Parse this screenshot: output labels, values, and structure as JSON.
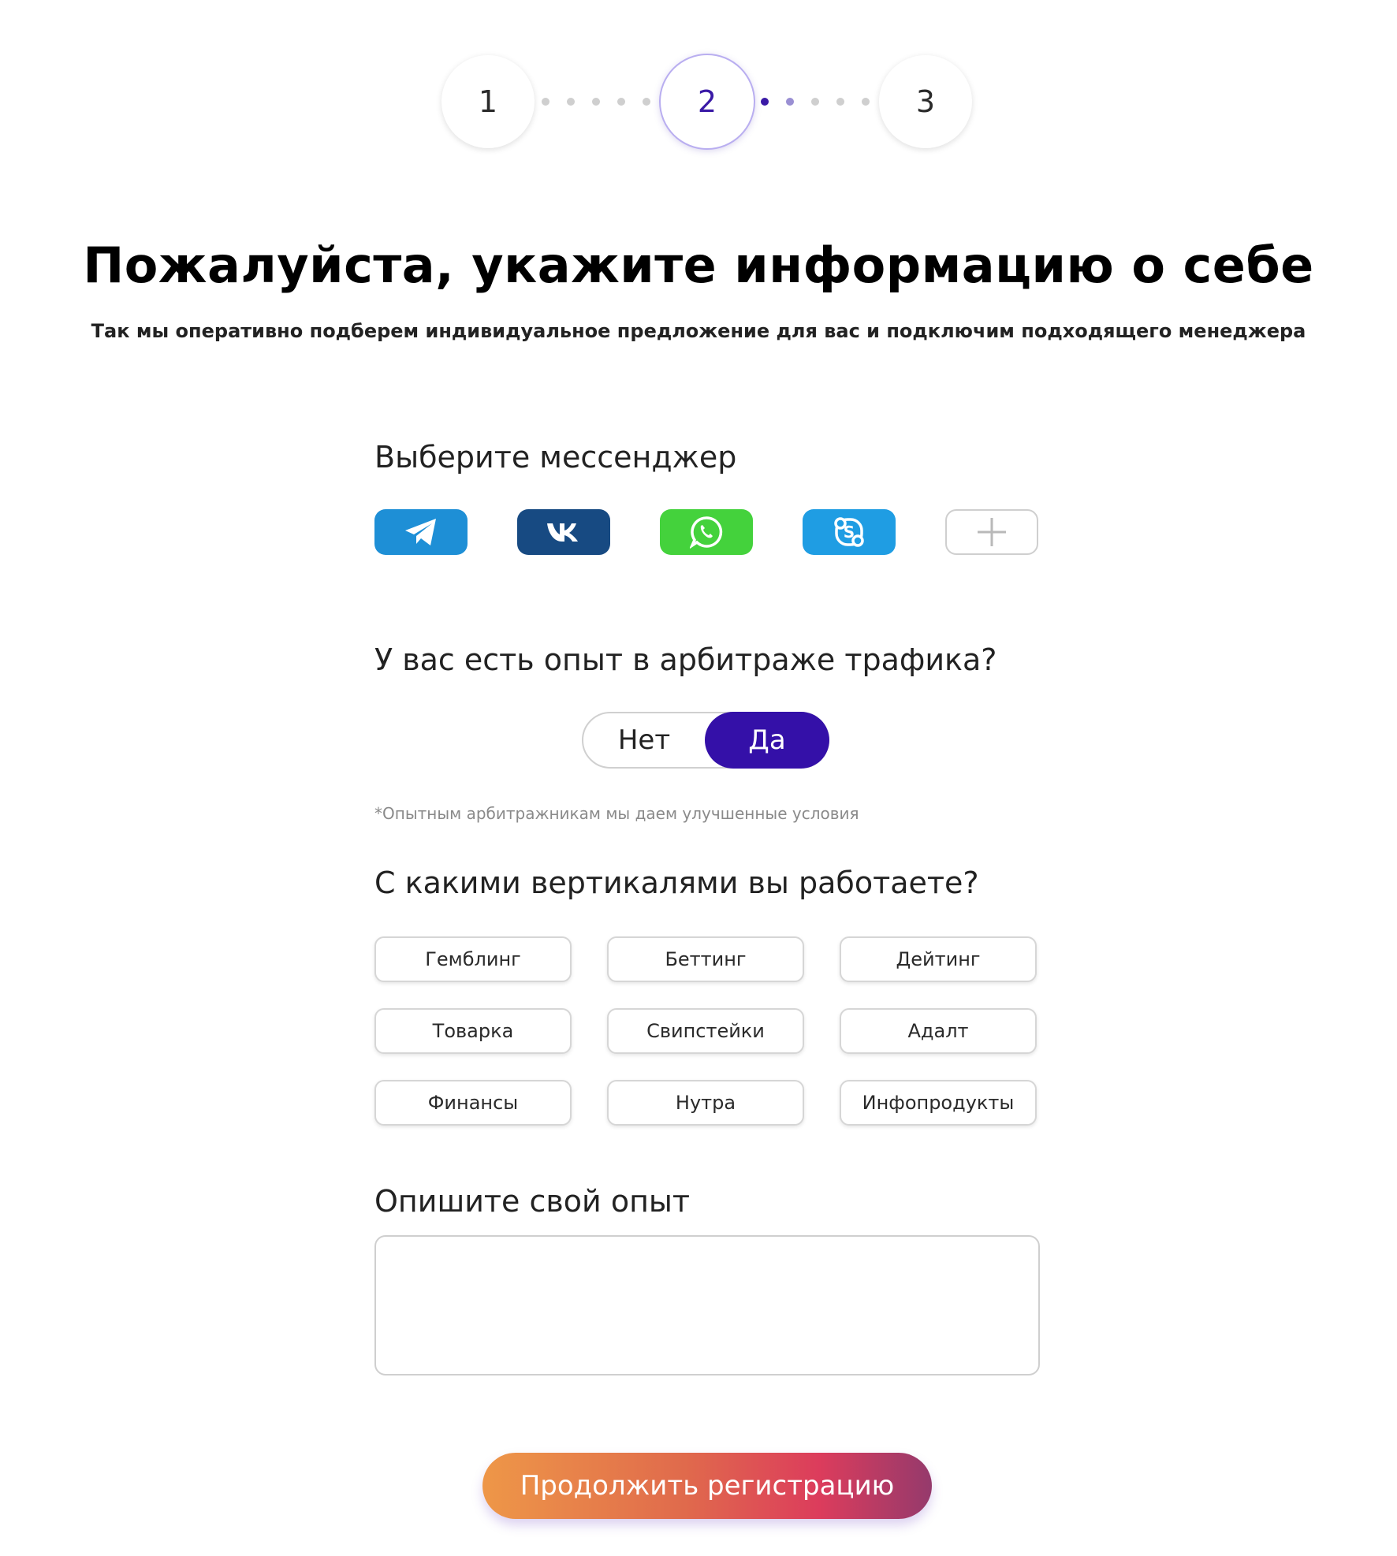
{
  "stepper": {
    "steps": [
      "1",
      "2",
      "3"
    ],
    "active_step": 2,
    "active_color": "#3a1aa6"
  },
  "header": {
    "title": "Пожалуйста, укажите информацию о себе",
    "subtitle": "Так мы оперативно подберем индивидуальное предложение для вас и подключим подходящего менеджера"
  },
  "messenger": {
    "label": "Выберите мессенджер",
    "options": [
      {
        "icon": "telegram-icon",
        "color": "#1e8fd6"
      },
      {
        "icon": "vk-icon",
        "color": "#174a82"
      },
      {
        "icon": "whatsapp-icon",
        "color": "#44d23c"
      },
      {
        "icon": "skype-icon",
        "color": "#1f9de3"
      },
      {
        "icon": "plus-icon",
        "color": "#ffffff"
      }
    ]
  },
  "experience": {
    "label": "У вас есть опыт в арбитраже трафика?",
    "options": [
      "Нет",
      "Да"
    ],
    "selected": "Да",
    "selected_color": "#3410a8",
    "note": "*Опытным арбитражникам мы даем улучшенные условия"
  },
  "verticals": {
    "label": "С какими вертикалями вы работаете?",
    "items": [
      "Гемблинг",
      "Беттинг",
      "Дейтинг",
      "Товарка",
      "Свипстейки",
      "Адалт",
      "Финансы",
      "Нутра",
      "Инфопродукты"
    ]
  },
  "description": {
    "label": "Опишите свой опыт",
    "value": ""
  },
  "submit": {
    "label": "Продолжить регистрацию"
  }
}
